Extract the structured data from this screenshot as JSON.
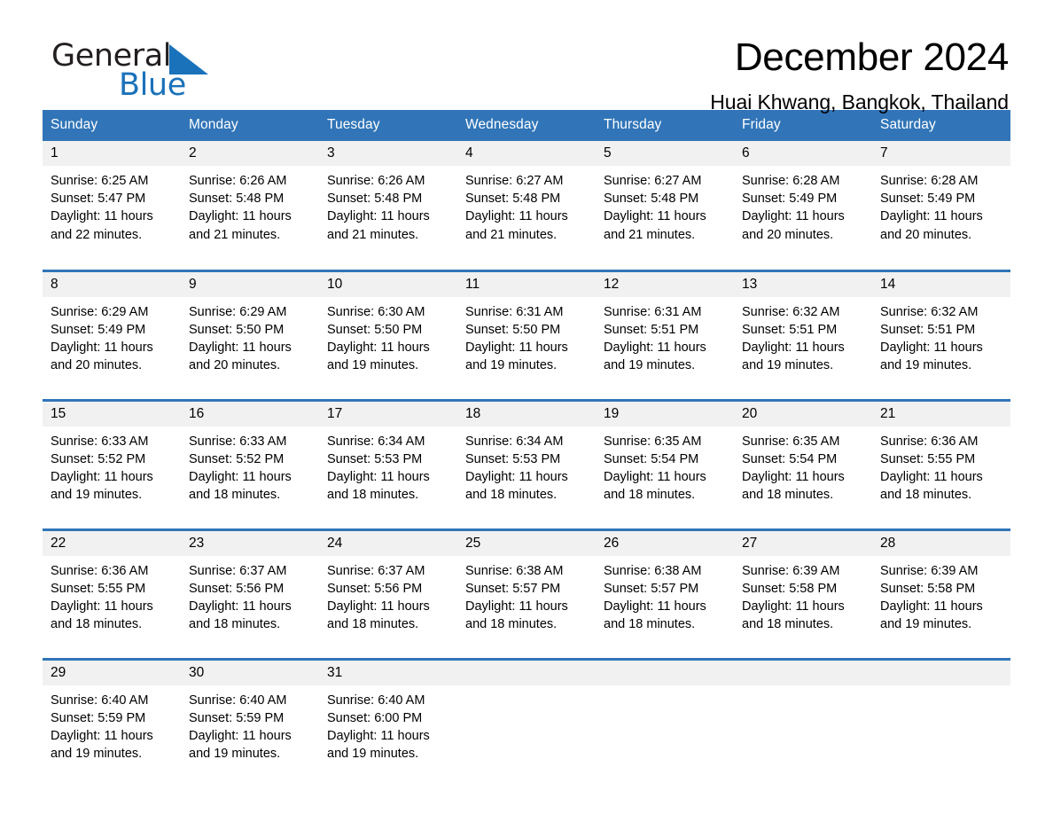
{
  "brand": {
    "name_part1": "General",
    "name_part2": "Blue",
    "triangle_icon": "triangle-icon",
    "accent_color": "#1a72ba"
  },
  "header": {
    "title": "December 2024",
    "location": "Huai Khwang, Bangkok, Thailand"
  },
  "calendar": {
    "header_color": "#3175b8",
    "daynum_band_color": "#f1f1f1",
    "weekday_headers": [
      "Sunday",
      "Monday",
      "Tuesday",
      "Wednesday",
      "Thursday",
      "Friday",
      "Saturday"
    ],
    "weeks": [
      [
        {
          "day": "1",
          "sunrise": "Sunrise: 6:25 AM",
          "sunset": "Sunset: 5:47 PM",
          "daylight_line1": "Daylight: 11 hours",
          "daylight_line2": "and 22 minutes."
        },
        {
          "day": "2",
          "sunrise": "Sunrise: 6:26 AM",
          "sunset": "Sunset: 5:48 PM",
          "daylight_line1": "Daylight: 11 hours",
          "daylight_line2": "and 21 minutes."
        },
        {
          "day": "3",
          "sunrise": "Sunrise: 6:26 AM",
          "sunset": "Sunset: 5:48 PM",
          "daylight_line1": "Daylight: 11 hours",
          "daylight_line2": "and 21 minutes."
        },
        {
          "day": "4",
          "sunrise": "Sunrise: 6:27 AM",
          "sunset": "Sunset: 5:48 PM",
          "daylight_line1": "Daylight: 11 hours",
          "daylight_line2": "and 21 minutes."
        },
        {
          "day": "5",
          "sunrise": "Sunrise: 6:27 AM",
          "sunset": "Sunset: 5:48 PM",
          "daylight_line1": "Daylight: 11 hours",
          "daylight_line2": "and 21 minutes."
        },
        {
          "day": "6",
          "sunrise": "Sunrise: 6:28 AM",
          "sunset": "Sunset: 5:49 PM",
          "daylight_line1": "Daylight: 11 hours",
          "daylight_line2": "and 20 minutes."
        },
        {
          "day": "7",
          "sunrise": "Sunrise: 6:28 AM",
          "sunset": "Sunset: 5:49 PM",
          "daylight_line1": "Daylight: 11 hours",
          "daylight_line2": "and 20 minutes."
        }
      ],
      [
        {
          "day": "8",
          "sunrise": "Sunrise: 6:29 AM",
          "sunset": "Sunset: 5:49 PM",
          "daylight_line1": "Daylight: 11 hours",
          "daylight_line2": "and 20 minutes."
        },
        {
          "day": "9",
          "sunrise": "Sunrise: 6:29 AM",
          "sunset": "Sunset: 5:50 PM",
          "daylight_line1": "Daylight: 11 hours",
          "daylight_line2": "and 20 minutes."
        },
        {
          "day": "10",
          "sunrise": "Sunrise: 6:30 AM",
          "sunset": "Sunset: 5:50 PM",
          "daylight_line1": "Daylight: 11 hours",
          "daylight_line2": "and 19 minutes."
        },
        {
          "day": "11",
          "sunrise": "Sunrise: 6:31 AM",
          "sunset": "Sunset: 5:50 PM",
          "daylight_line1": "Daylight: 11 hours",
          "daylight_line2": "and 19 minutes."
        },
        {
          "day": "12",
          "sunrise": "Sunrise: 6:31 AM",
          "sunset": "Sunset: 5:51 PM",
          "daylight_line1": "Daylight: 11 hours",
          "daylight_line2": "and 19 minutes."
        },
        {
          "day": "13",
          "sunrise": "Sunrise: 6:32 AM",
          "sunset": "Sunset: 5:51 PM",
          "daylight_line1": "Daylight: 11 hours",
          "daylight_line2": "and 19 minutes."
        },
        {
          "day": "14",
          "sunrise": "Sunrise: 6:32 AM",
          "sunset": "Sunset: 5:51 PM",
          "daylight_line1": "Daylight: 11 hours",
          "daylight_line2": "and 19 minutes."
        }
      ],
      [
        {
          "day": "15",
          "sunrise": "Sunrise: 6:33 AM",
          "sunset": "Sunset: 5:52 PM",
          "daylight_line1": "Daylight: 11 hours",
          "daylight_line2": "and 19 minutes."
        },
        {
          "day": "16",
          "sunrise": "Sunrise: 6:33 AM",
          "sunset": "Sunset: 5:52 PM",
          "daylight_line1": "Daylight: 11 hours",
          "daylight_line2": "and 18 minutes."
        },
        {
          "day": "17",
          "sunrise": "Sunrise: 6:34 AM",
          "sunset": "Sunset: 5:53 PM",
          "daylight_line1": "Daylight: 11 hours",
          "daylight_line2": "and 18 minutes."
        },
        {
          "day": "18",
          "sunrise": "Sunrise: 6:34 AM",
          "sunset": "Sunset: 5:53 PM",
          "daylight_line1": "Daylight: 11 hours",
          "daylight_line2": "and 18 minutes."
        },
        {
          "day": "19",
          "sunrise": "Sunrise: 6:35 AM",
          "sunset": "Sunset: 5:54 PM",
          "daylight_line1": "Daylight: 11 hours",
          "daylight_line2": "and 18 minutes."
        },
        {
          "day": "20",
          "sunrise": "Sunrise: 6:35 AM",
          "sunset": "Sunset: 5:54 PM",
          "daylight_line1": "Daylight: 11 hours",
          "daylight_line2": "and 18 minutes."
        },
        {
          "day": "21",
          "sunrise": "Sunrise: 6:36 AM",
          "sunset": "Sunset: 5:55 PM",
          "daylight_line1": "Daylight: 11 hours",
          "daylight_line2": "and 18 minutes."
        }
      ],
      [
        {
          "day": "22",
          "sunrise": "Sunrise: 6:36 AM",
          "sunset": "Sunset: 5:55 PM",
          "daylight_line1": "Daylight: 11 hours",
          "daylight_line2": "and 18 minutes."
        },
        {
          "day": "23",
          "sunrise": "Sunrise: 6:37 AM",
          "sunset": "Sunset: 5:56 PM",
          "daylight_line1": "Daylight: 11 hours",
          "daylight_line2": "and 18 minutes."
        },
        {
          "day": "24",
          "sunrise": "Sunrise: 6:37 AM",
          "sunset": "Sunset: 5:56 PM",
          "daylight_line1": "Daylight: 11 hours",
          "daylight_line2": "and 18 minutes."
        },
        {
          "day": "25",
          "sunrise": "Sunrise: 6:38 AM",
          "sunset": "Sunset: 5:57 PM",
          "daylight_line1": "Daylight: 11 hours",
          "daylight_line2": "and 18 minutes."
        },
        {
          "day": "26",
          "sunrise": "Sunrise: 6:38 AM",
          "sunset": "Sunset: 5:57 PM",
          "daylight_line1": "Daylight: 11 hours",
          "daylight_line2": "and 18 minutes."
        },
        {
          "day": "27",
          "sunrise": "Sunrise: 6:39 AM",
          "sunset": "Sunset: 5:58 PM",
          "daylight_line1": "Daylight: 11 hours",
          "daylight_line2": "and 18 minutes."
        },
        {
          "day": "28",
          "sunrise": "Sunrise: 6:39 AM",
          "sunset": "Sunset: 5:58 PM",
          "daylight_line1": "Daylight: 11 hours",
          "daylight_line2": "and 19 minutes."
        }
      ],
      [
        {
          "day": "29",
          "sunrise": "Sunrise: 6:40 AM",
          "sunset": "Sunset: 5:59 PM",
          "daylight_line1": "Daylight: 11 hours",
          "daylight_line2": "and 19 minutes."
        },
        {
          "day": "30",
          "sunrise": "Sunrise: 6:40 AM",
          "sunset": "Sunset: 5:59 PM",
          "daylight_line1": "Daylight: 11 hours",
          "daylight_line2": "and 19 minutes."
        },
        {
          "day": "31",
          "sunrise": "Sunrise: 6:40 AM",
          "sunset": "Sunset: 6:00 PM",
          "daylight_line1": "Daylight: 11 hours",
          "daylight_line2": "and 19 minutes."
        },
        {
          "day": "",
          "sunrise": "",
          "sunset": "",
          "daylight_line1": "",
          "daylight_line2": ""
        },
        {
          "day": "",
          "sunrise": "",
          "sunset": "",
          "daylight_line1": "",
          "daylight_line2": ""
        },
        {
          "day": "",
          "sunrise": "",
          "sunset": "",
          "daylight_line1": "",
          "daylight_line2": ""
        },
        {
          "day": "",
          "sunrise": "",
          "sunset": "",
          "daylight_line1": "",
          "daylight_line2": ""
        }
      ]
    ]
  }
}
